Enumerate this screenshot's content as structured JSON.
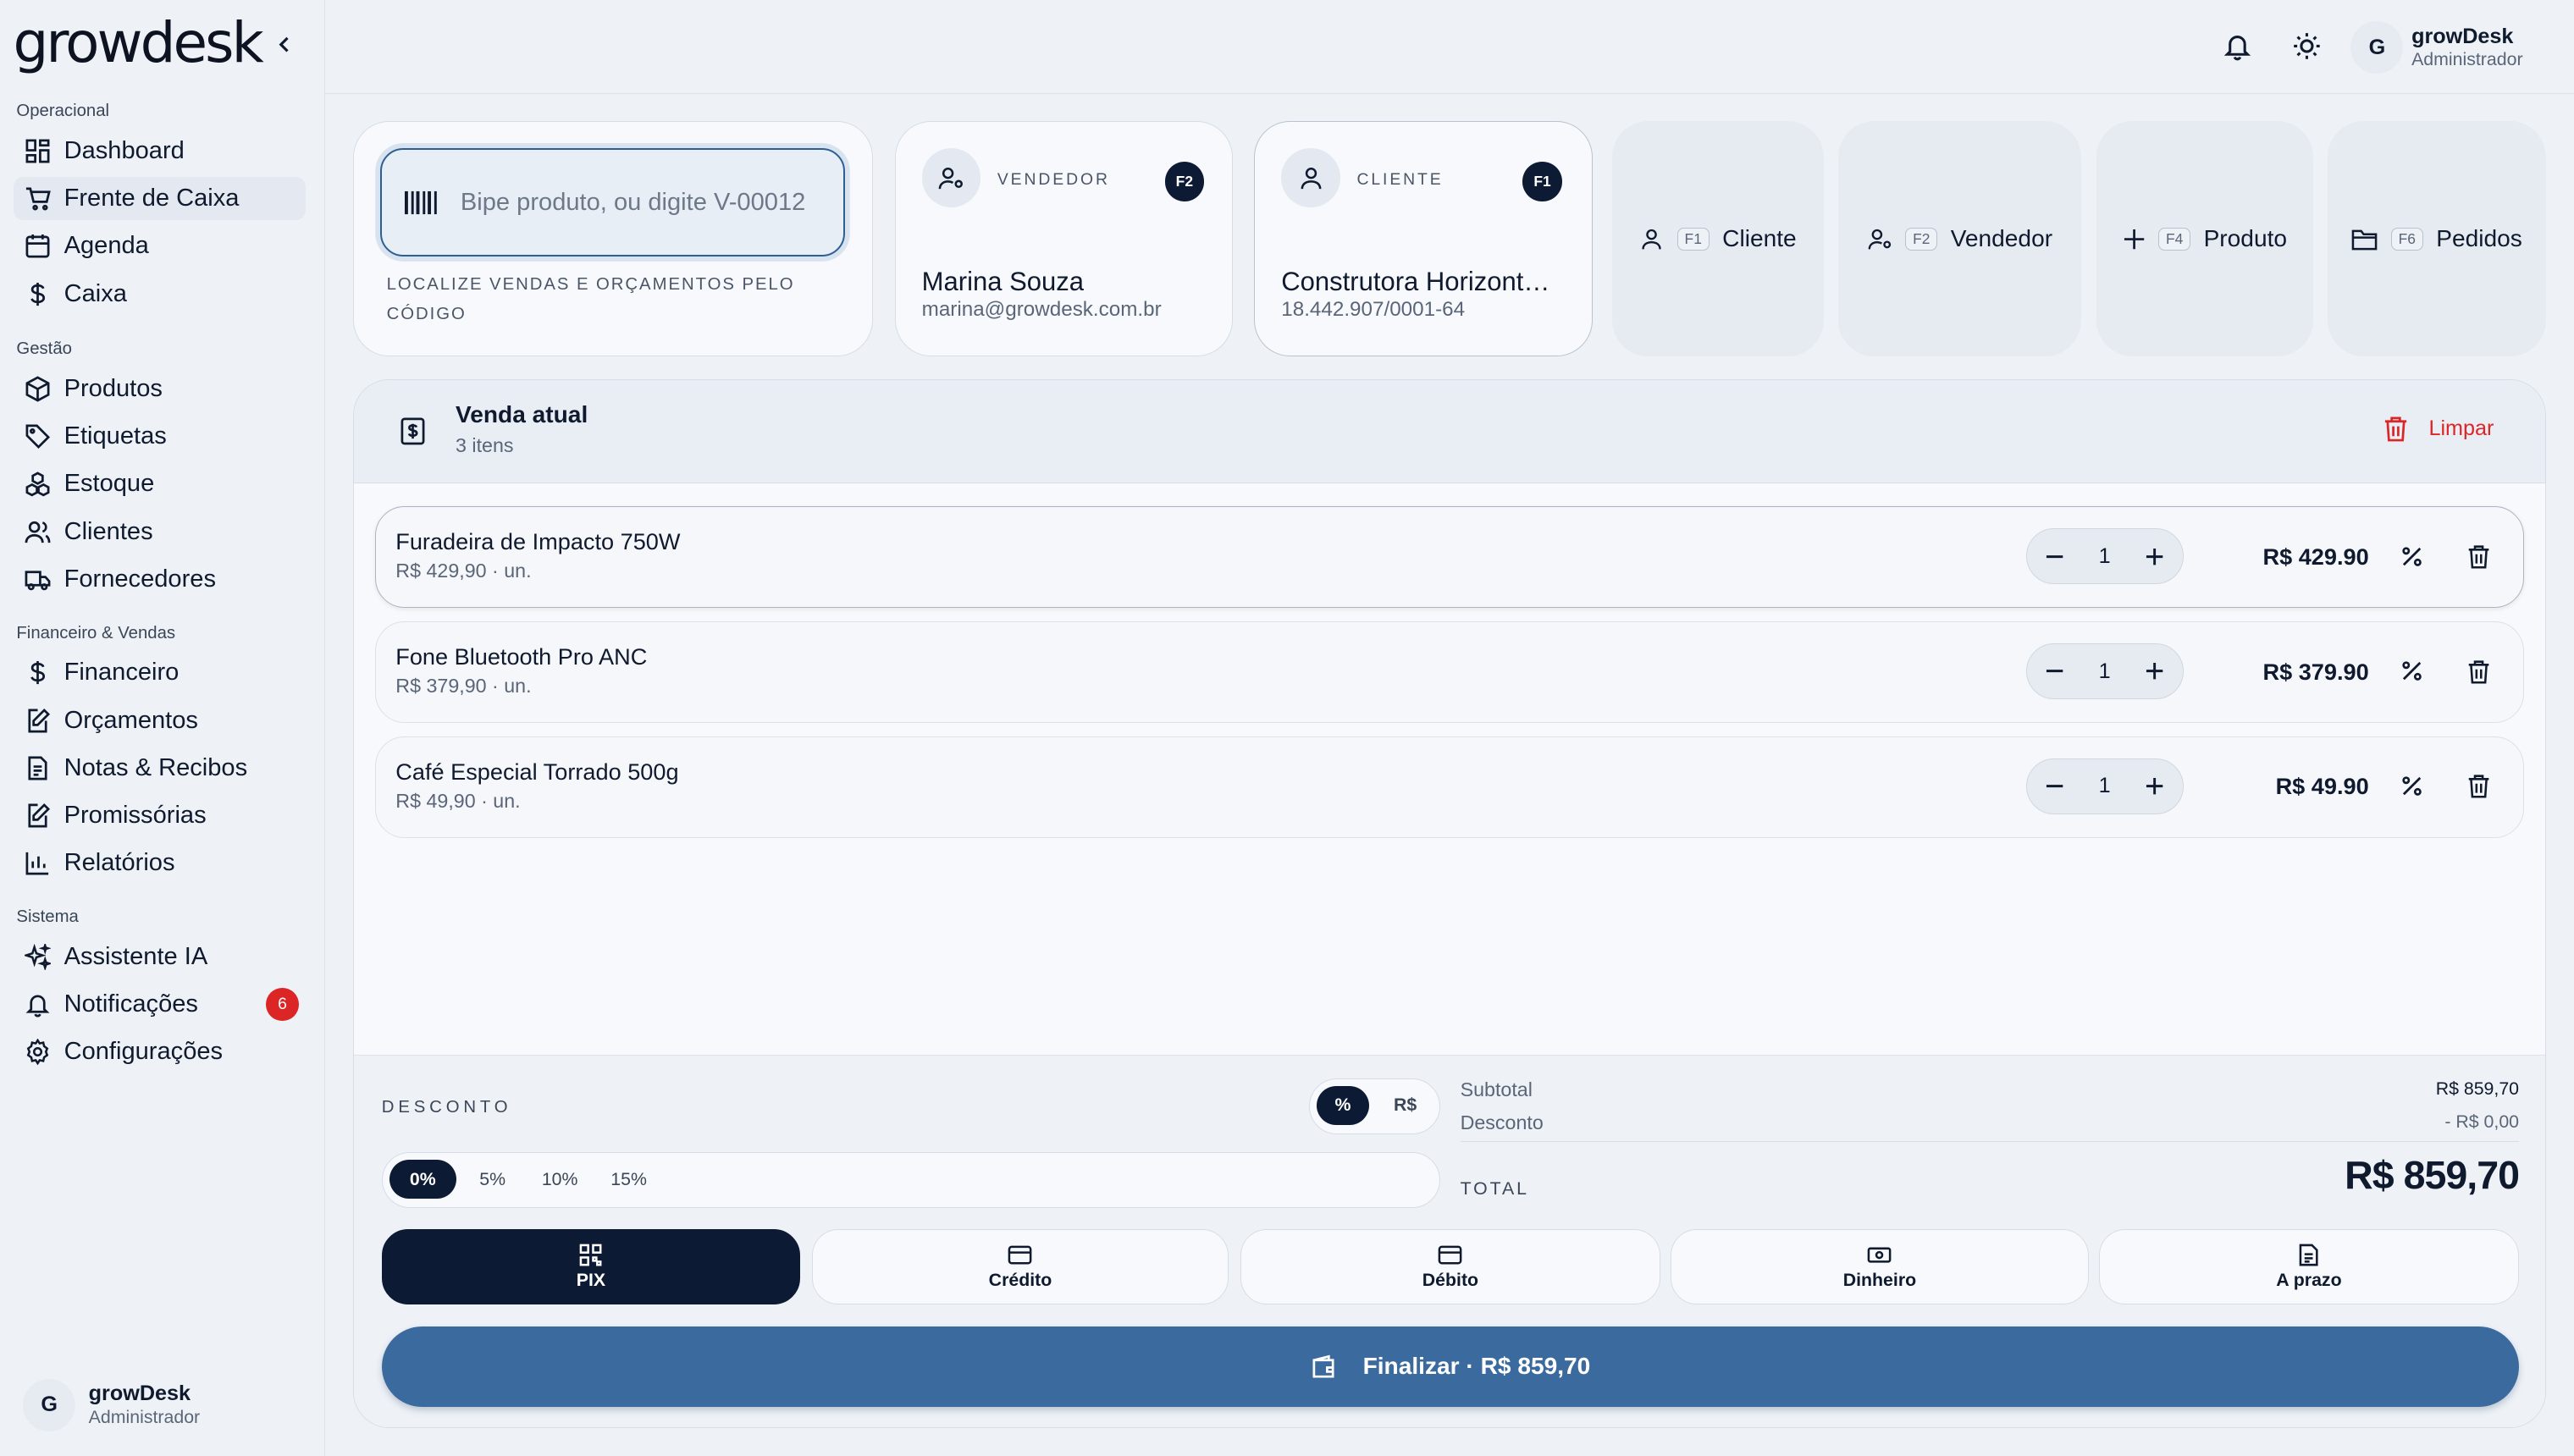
{
  "app": {
    "logo": "growdesk"
  },
  "sidebar": {
    "sections": [
      "Operacional",
      "Gestão",
      "Financeiro & Vendas",
      "Sistema"
    ],
    "items": [
      {
        "label": "Dashboard",
        "icon": "dashboard-icon"
      },
      {
        "label": "Frente de Caixa",
        "icon": "cart-icon"
      },
      {
        "label": "Agenda",
        "icon": "calendar-icon"
      },
      {
        "label": "Caixa",
        "icon": "dollar-icon"
      },
      {
        "label": "Produtos",
        "icon": "box-icon"
      },
      {
        "label": "Etiquetas",
        "icon": "tag-icon"
      },
      {
        "label": "Estoque",
        "icon": "stock-icon"
      },
      {
        "label": "Clientes",
        "icon": "users-icon"
      },
      {
        "label": "Fornecedores",
        "icon": "truck-icon"
      },
      {
        "label": "Financeiro",
        "icon": "dollar-icon"
      },
      {
        "label": "Orçamentos",
        "icon": "edit-doc-icon"
      },
      {
        "label": "Notas & Recibos",
        "icon": "receipt-icon"
      },
      {
        "label": "Promissórias",
        "icon": "edit-doc-icon"
      },
      {
        "label": "Relatórios",
        "icon": "bar-chart-icon"
      },
      {
        "label": "Assistente IA",
        "icon": "sparkles-icon"
      },
      {
        "label": "Notificações",
        "icon": "bell-icon",
        "badge": "6"
      },
      {
        "label": "Configurações",
        "icon": "gear-icon"
      }
    ],
    "active": "Frente de Caixa"
  },
  "user": {
    "initial": "G",
    "name": "growDesk",
    "role": "Administrador"
  },
  "scanner": {
    "placeholder": "Bipe produto, ou digite V-00012",
    "hint": "LOCALIZE VENDAS E ORÇAMENTOS PELO CÓDIGO"
  },
  "seller": {
    "label": "VENDEDOR",
    "key": "F2",
    "name": "Marina Souza",
    "sub": "marina@growdesk.com.br"
  },
  "client": {
    "label": "CLIENTE",
    "key": "F1",
    "name": "Construtora Horizonte Ltda",
    "sub": "18.442.907/0001-64"
  },
  "quick": [
    {
      "key": "F1",
      "label": "Cliente",
      "icon": "user-icon"
    },
    {
      "key": "F2",
      "label": "Vendedor",
      "icon": "user-gear-icon"
    },
    {
      "key": "F4",
      "label": "Produto",
      "icon": "plus-icon"
    },
    {
      "key": "F6",
      "label": "Pedidos",
      "icon": "folder-icon"
    }
  ],
  "sale": {
    "title": "Venda atual",
    "count": "3 itens",
    "clear": "Limpar",
    "items": [
      {
        "name": "Furadeira de Impacto 750W",
        "unit": "R$ 429,90 · un.",
        "qty": "1",
        "total": "R$ 429.90"
      },
      {
        "name": "Fone Bluetooth Pro ANC",
        "unit": "R$ 379,90 · un.",
        "qty": "1",
        "total": "R$ 379.90"
      },
      {
        "name": "Café Especial Torrado 500g",
        "unit": "R$ 49,90 · un.",
        "qty": "1",
        "total": "R$ 49.90"
      }
    ]
  },
  "discount": {
    "label": "DESCONTO",
    "modes": [
      "%",
      "R$"
    ],
    "active_mode": "%",
    "presets": [
      "0%",
      "5%",
      "10%",
      "15%"
    ],
    "active_preset": "0%"
  },
  "summary": {
    "subtotal_label": "Subtotal",
    "subtotal": "R$ 859,70",
    "discount_label": "Desconto",
    "discount": "- R$ 0,00",
    "total_label": "TOTAL",
    "total": "R$ 859,70"
  },
  "payments": [
    {
      "label": "PIX",
      "icon": "qr-icon"
    },
    {
      "label": "Crédito",
      "icon": "card-icon"
    },
    {
      "label": "Débito",
      "icon": "card-icon"
    },
    {
      "label": "Dinheiro",
      "icon": "cash-icon"
    },
    {
      "label": "A prazo",
      "icon": "doc-icon"
    }
  ],
  "active_payment": "PIX",
  "finalize": "Finalizar · R$ 859,70",
  "colors": {
    "primary": "#0d1a33",
    "accent": "#3b6b9e",
    "danger": "#dc2626"
  }
}
